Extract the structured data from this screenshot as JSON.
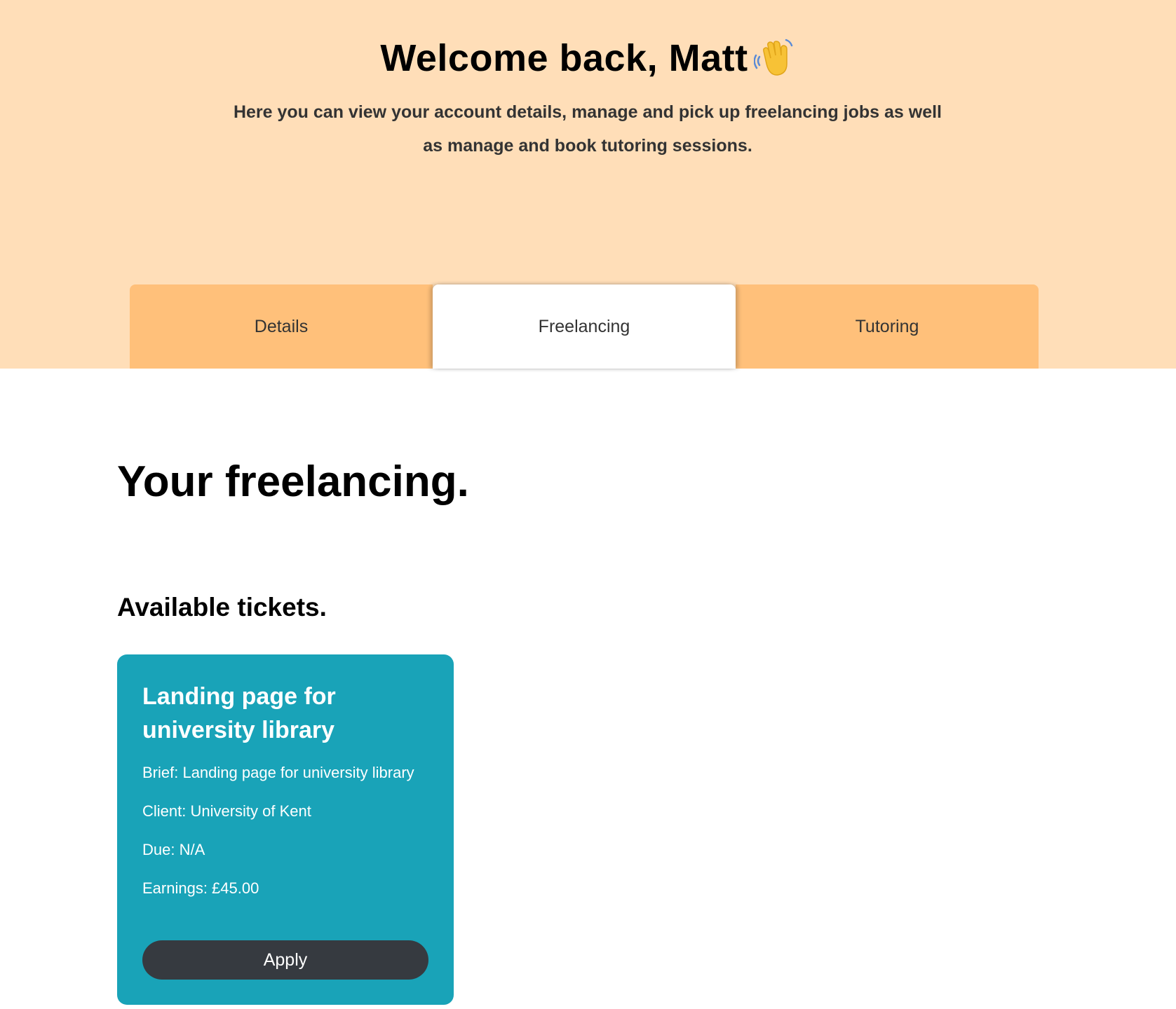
{
  "hero": {
    "title": "Welcome back, Matt",
    "title_icon": "waving-hand-icon",
    "subtitle": "Here you can view your account details, manage and pick up freelancing jobs as well as manage and book tutoring sessions.",
    "background_color": "#ffdeb8"
  },
  "tabs": {
    "items": [
      {
        "label": "Details",
        "active": false
      },
      {
        "label": "Freelancing",
        "active": true
      },
      {
        "label": "Tutoring",
        "active": false
      }
    ],
    "inactive_color": "#ffc07a",
    "active_color": "#ffffff"
  },
  "main": {
    "title": "Your freelancing.",
    "available_title": "Available tickets."
  },
  "tickets": [
    {
      "title": "Landing page for university library",
      "brief": "Brief: Landing page for university library",
      "client": "Client: University of Kent",
      "due": "Due: N/A",
      "earnings": "Earnings: £45.00",
      "button_label": "Apply",
      "card_color": "#19a3b8",
      "button_color": "#363a40"
    }
  ]
}
